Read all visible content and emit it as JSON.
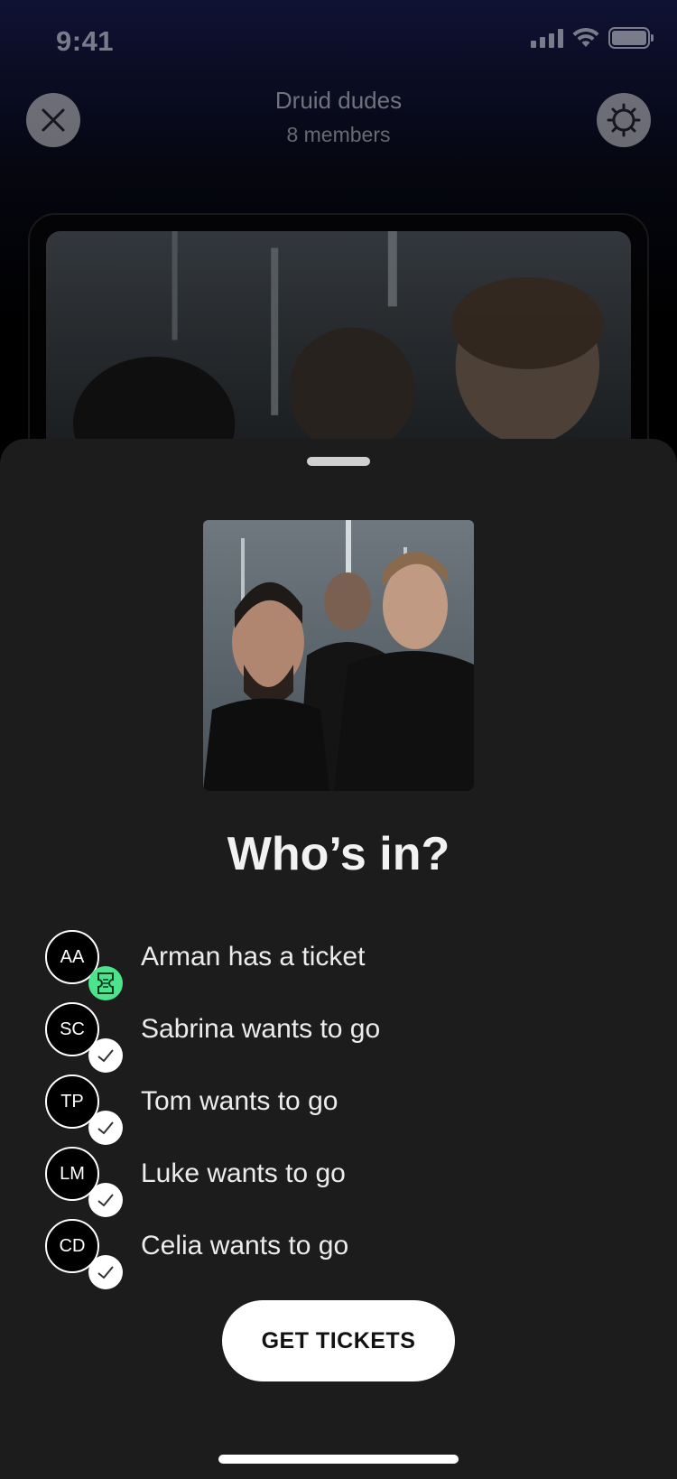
{
  "status_bar": {
    "time": "9:41"
  },
  "header": {
    "title": "Druid dudes",
    "subtitle": "8 members"
  },
  "sheet": {
    "title": "Who’s in?",
    "members": [
      {
        "initials": "AA",
        "label": "Arman has a ticket",
        "badge": "ticket-icon"
      },
      {
        "initials": "SC",
        "label": "Sabrina wants to go",
        "badge": "check-icon"
      },
      {
        "initials": "TP",
        "label": "Tom wants to go",
        "badge": "check-icon"
      },
      {
        "initials": "LM",
        "label": "Luke wants to go",
        "badge": "check-icon"
      },
      {
        "initials": "CD",
        "label": "Celia wants to go",
        "badge": "check-icon"
      }
    ],
    "cta_label": "GET TICKETS"
  },
  "colors": {
    "sheet_background": "#1c1c1c",
    "ticket_badge": "#4de28c",
    "button_background": "#ffffff"
  }
}
